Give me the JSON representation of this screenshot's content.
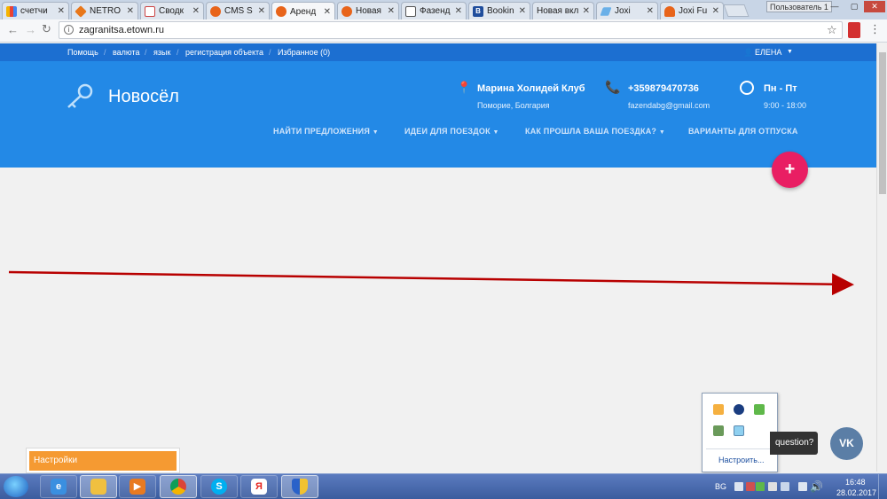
{
  "browser": {
    "tabs": [
      {
        "label": "счетчи",
        "active": false
      },
      {
        "label": "NETRO",
        "active": false
      },
      {
        "label": "Сводк",
        "active": false
      },
      {
        "label": "CMS S",
        "active": false
      },
      {
        "label": "Аренд",
        "active": true
      },
      {
        "label": "Новая",
        "active": false
      },
      {
        "label": "Фазенд",
        "active": false
      },
      {
        "label": "Bookin",
        "active": false
      },
      {
        "label": "Новая вкл",
        "active": false
      },
      {
        "label": "Joxi",
        "active": false
      },
      {
        "label": "Joxi Fu",
        "active": false
      }
    ],
    "user_badge": "Пользователь 1",
    "url": "zagranitsa.etown.ru"
  },
  "site": {
    "topbar": {
      "links": [
        "Помощь",
        "валюта",
        "язык",
        "регистрация объекта",
        "Избранное (0)"
      ],
      "user_label": "ЕЛЕНА"
    },
    "title": "Новосёл",
    "contact": {
      "place_name": "Марина Холидей Клуб",
      "place_location": "Поморие, Болгария",
      "phone": "+359879470736",
      "email": "fazendabg@gmail.com",
      "days": "Пн - Пт",
      "hours": "9:00 - 18:00"
    },
    "nav": [
      {
        "label": "НАЙТИ ПРЕДЛОЖЕНИЯ",
        "dropdown": true
      },
      {
        "label": "ИДЕИ ДЛЯ ПОЕЗДОК",
        "dropdown": true
      },
      {
        "label": "КАК ПРОШЛА ВАША ПОЕЗДКА?",
        "dropdown": true
      },
      {
        "label": "ВАРИАНТЫ ДЛЯ ОТПУСКА",
        "dropdown": false
      }
    ],
    "plus_label": "+",
    "question_text": "question?",
    "vk_label": "VK",
    "settings_label": "Настройки"
  },
  "tray_popup": {
    "customize_label": "Настроить..."
  },
  "taskbar": {
    "language": "BG",
    "time": "16:48",
    "date": "28.02.2017"
  },
  "colors": {
    "header_blue": "#2389e6",
    "topbar_blue": "#1c6fd1",
    "plus_pink": "#e91e63",
    "arrow_red": "#b80000",
    "settings_orange": "#f59a32"
  }
}
